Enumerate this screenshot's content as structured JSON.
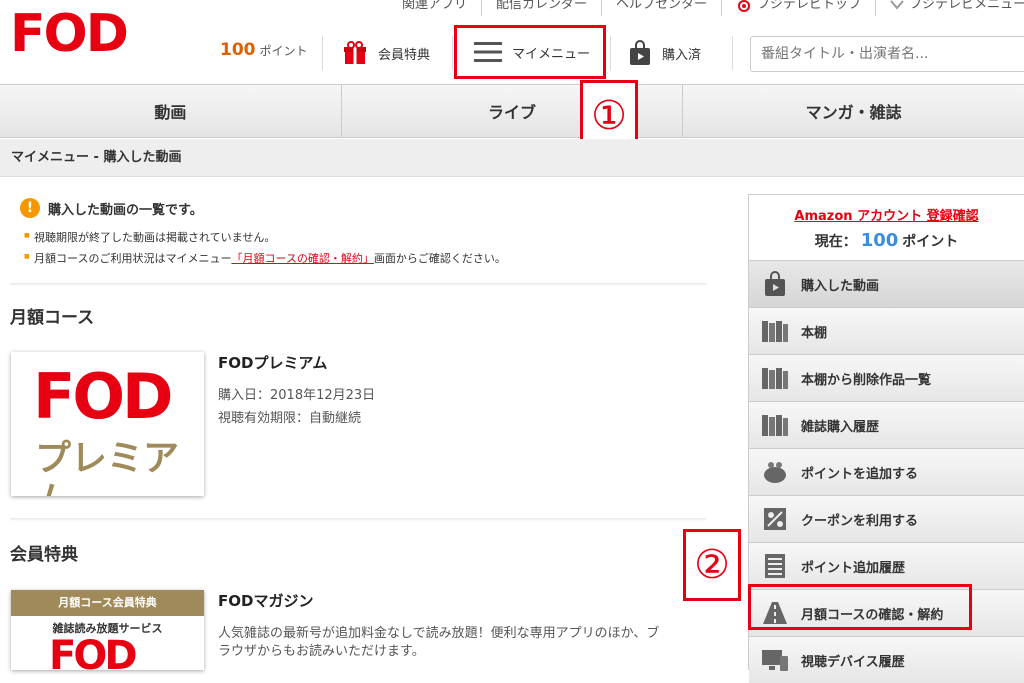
{
  "header": {
    "logo": "FOD",
    "top_links": [
      "関連アプリ",
      "配信カレンダー",
      "ヘルプセンター",
      "フジテレビトップ",
      "フジテレビメニュー"
    ],
    "points_value": "100",
    "points_unit": "ポイント",
    "member_benefits": "会員特典",
    "my_menu": "マイメニュー",
    "purchased": "購入済",
    "search_placeholder": "番組タイトル・出演者名..."
  },
  "tabs": [
    "動画",
    "ライブ",
    "マンガ・雑誌"
  ],
  "breadcrumb": "マイメニュー - 購入した動画",
  "notice": {
    "title": "購入した動画の一覧です。",
    "line1": "視聴期限が終了した動画は掲載されていません。",
    "line2_prefix": "月額コースのご利用状況はマイメニュー",
    "line2_link": "「月額コースの確認・解約」",
    "line2_suffix": "画面からご確認ください。"
  },
  "monthly": {
    "section_title": "月額コース",
    "logo_top": "FOD",
    "logo_bottom": "プレミアム",
    "name": "FODプレミアム",
    "purchase_date": "購入日：2018年12月23日",
    "expiry": "視聴有効期限：自動継続"
  },
  "benefits": {
    "section_title": "会員特典",
    "banner": "月額コース会員特典",
    "sub": "雑誌読み放題サービス",
    "logo": "FOD",
    "name": "FODマガジン",
    "desc1": "人気雑誌の最新号が追加料金なしで読み放題！便利な専用アプリのほか、ブ",
    "desc2": "ラウザからもお読みいただけます。"
  },
  "sidebar": {
    "amazon_link": "Amazon アカウント 登録確認",
    "current_prefix": "現在：",
    "current_value": "100",
    "current_unit": "ポイント",
    "items": [
      {
        "label": "購入した動画",
        "icon": "shopping-bag-icon"
      },
      {
        "label": "本棚",
        "icon": "bookshelf-icon"
      },
      {
        "label": "本棚から削除作品一覧",
        "icon": "bookshelf-icon"
      },
      {
        "label": "雑誌購入履歴",
        "icon": "bookshelf-icon"
      },
      {
        "label": "ポイントを追加する",
        "icon": "coin-purse-icon"
      },
      {
        "label": "クーポンを利用する",
        "icon": "coupon-icon"
      },
      {
        "label": "ポイント追加履歴",
        "icon": "list-icon"
      },
      {
        "label": "月額コースの確認・解約",
        "icon": "road-icon"
      },
      {
        "label": "視聴デバイス履歴",
        "icon": "device-icon"
      }
    ]
  },
  "annotations": {
    "one": "①",
    "two": "②"
  },
  "colors": {
    "brand_red": "#e60012",
    "points_orange": "#e06000",
    "points_blue": "#3b8de0"
  }
}
